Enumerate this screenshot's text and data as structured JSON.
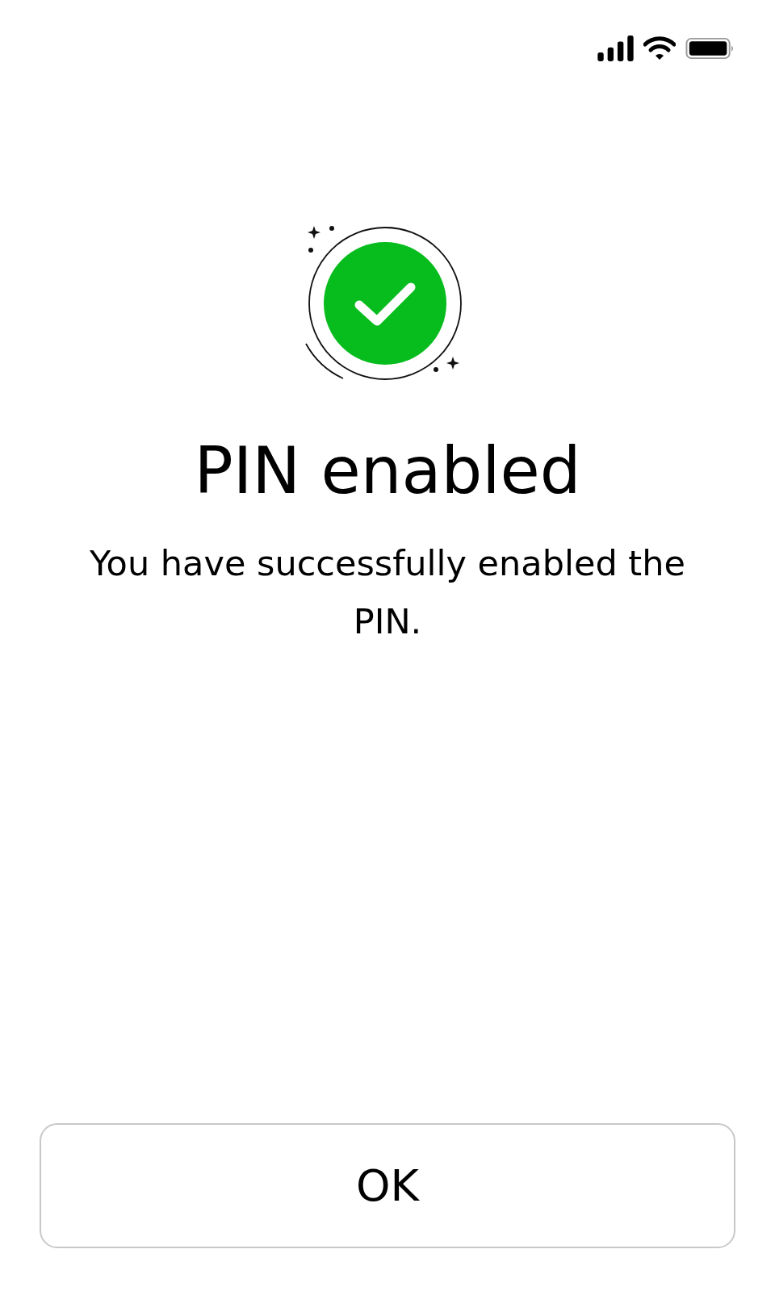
{
  "title": "PIN enabled",
  "message": "You have successfully enabled the PIN.",
  "button": {
    "label": "OK"
  }
}
